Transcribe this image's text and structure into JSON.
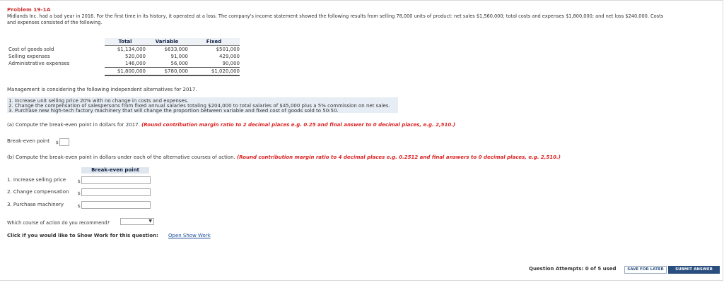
{
  "problem": {
    "title": "Problem 19-1A",
    "intro_line1": "Midlands Inc. had a bad year in 2016. For the first time in its history, it operated at a loss. The company's income statement showed the following results from selling 78,000 units of product: net sales $1,560,000; total costs and expenses $1,800,000; and net loss $240,000. Costs",
    "intro_line2": "and expenses consisted of the following."
  },
  "cost_table": {
    "headers": [
      "Total",
      "Variable",
      "Fixed"
    ],
    "rows": [
      {
        "label": "Cost of goods sold",
        "total": "$1,134,000",
        "variable": "$633,000",
        "fixed": "$501,000"
      },
      {
        "label": "Selling expenses",
        "total": "520,000",
        "variable": "91,000",
        "fixed": "429,000"
      },
      {
        "label": "Administrative expenses",
        "total": "146,000",
        "variable": "56,000",
        "fixed": "90,000"
      }
    ],
    "totals": {
      "total": "$1,800,000",
      "variable": "$780,000",
      "fixed": "$1,020,000"
    }
  },
  "alternatives": {
    "intro": "Management is considering the following independent alternatives for 2017.",
    "items": [
      "1.  Increase unit selling price 20% with no change in costs and expenses.",
      "2.  Change the compensation of salespersons from fixed annual salaries totaling $204,000 to total salaries of $45,000 plus a 5% commission on net sales.",
      "3.  Purchase new high-tech factory machinery that will change the proportion between variable and fixed cost of goods sold to 50:50."
    ]
  },
  "part_a": {
    "question": "(a) Compute the break-even point in dollars for 2017. ",
    "instruction": "(Round contribution margin ratio to 2 decimal places e.g. 0.25 and final answer to 0 decimal places, e.g. 2,510.)",
    "label": "Break-even point",
    "currency": "$",
    "value": ""
  },
  "part_b": {
    "question": "(b) Compute the break-even point in dollars under each of the alternative courses of action. ",
    "instruction": "(Round contribution margin ratio to 4 decimal places e.g. 0.2512 and final answers to 0 decimal places, e.g. 2,510.)",
    "column_header": "Break-even point",
    "rows": [
      {
        "label": "1.  Increase selling price",
        "currency": "$",
        "value": ""
      },
      {
        "label": "2.  Change compensation",
        "currency": "$",
        "value": ""
      },
      {
        "label": "3.  Purchase machinery",
        "currency": "$",
        "value": ""
      }
    ]
  },
  "recommend": {
    "label": "Which course of action do you recommend?",
    "selected": ""
  },
  "show_work": {
    "label": "Click if you would like to Show Work for this question:",
    "link": "Open Show Work"
  },
  "footer": {
    "attempts": "Question Attempts: 0 of 5 used",
    "save_label": "SAVE FOR LATER",
    "submit_label": "SUBMIT ANSWER"
  },
  "colors": {
    "accent": "#2a4f7f",
    "title": "#cc3333",
    "instruction": "#dd2222",
    "link": "#1a4d99"
  }
}
